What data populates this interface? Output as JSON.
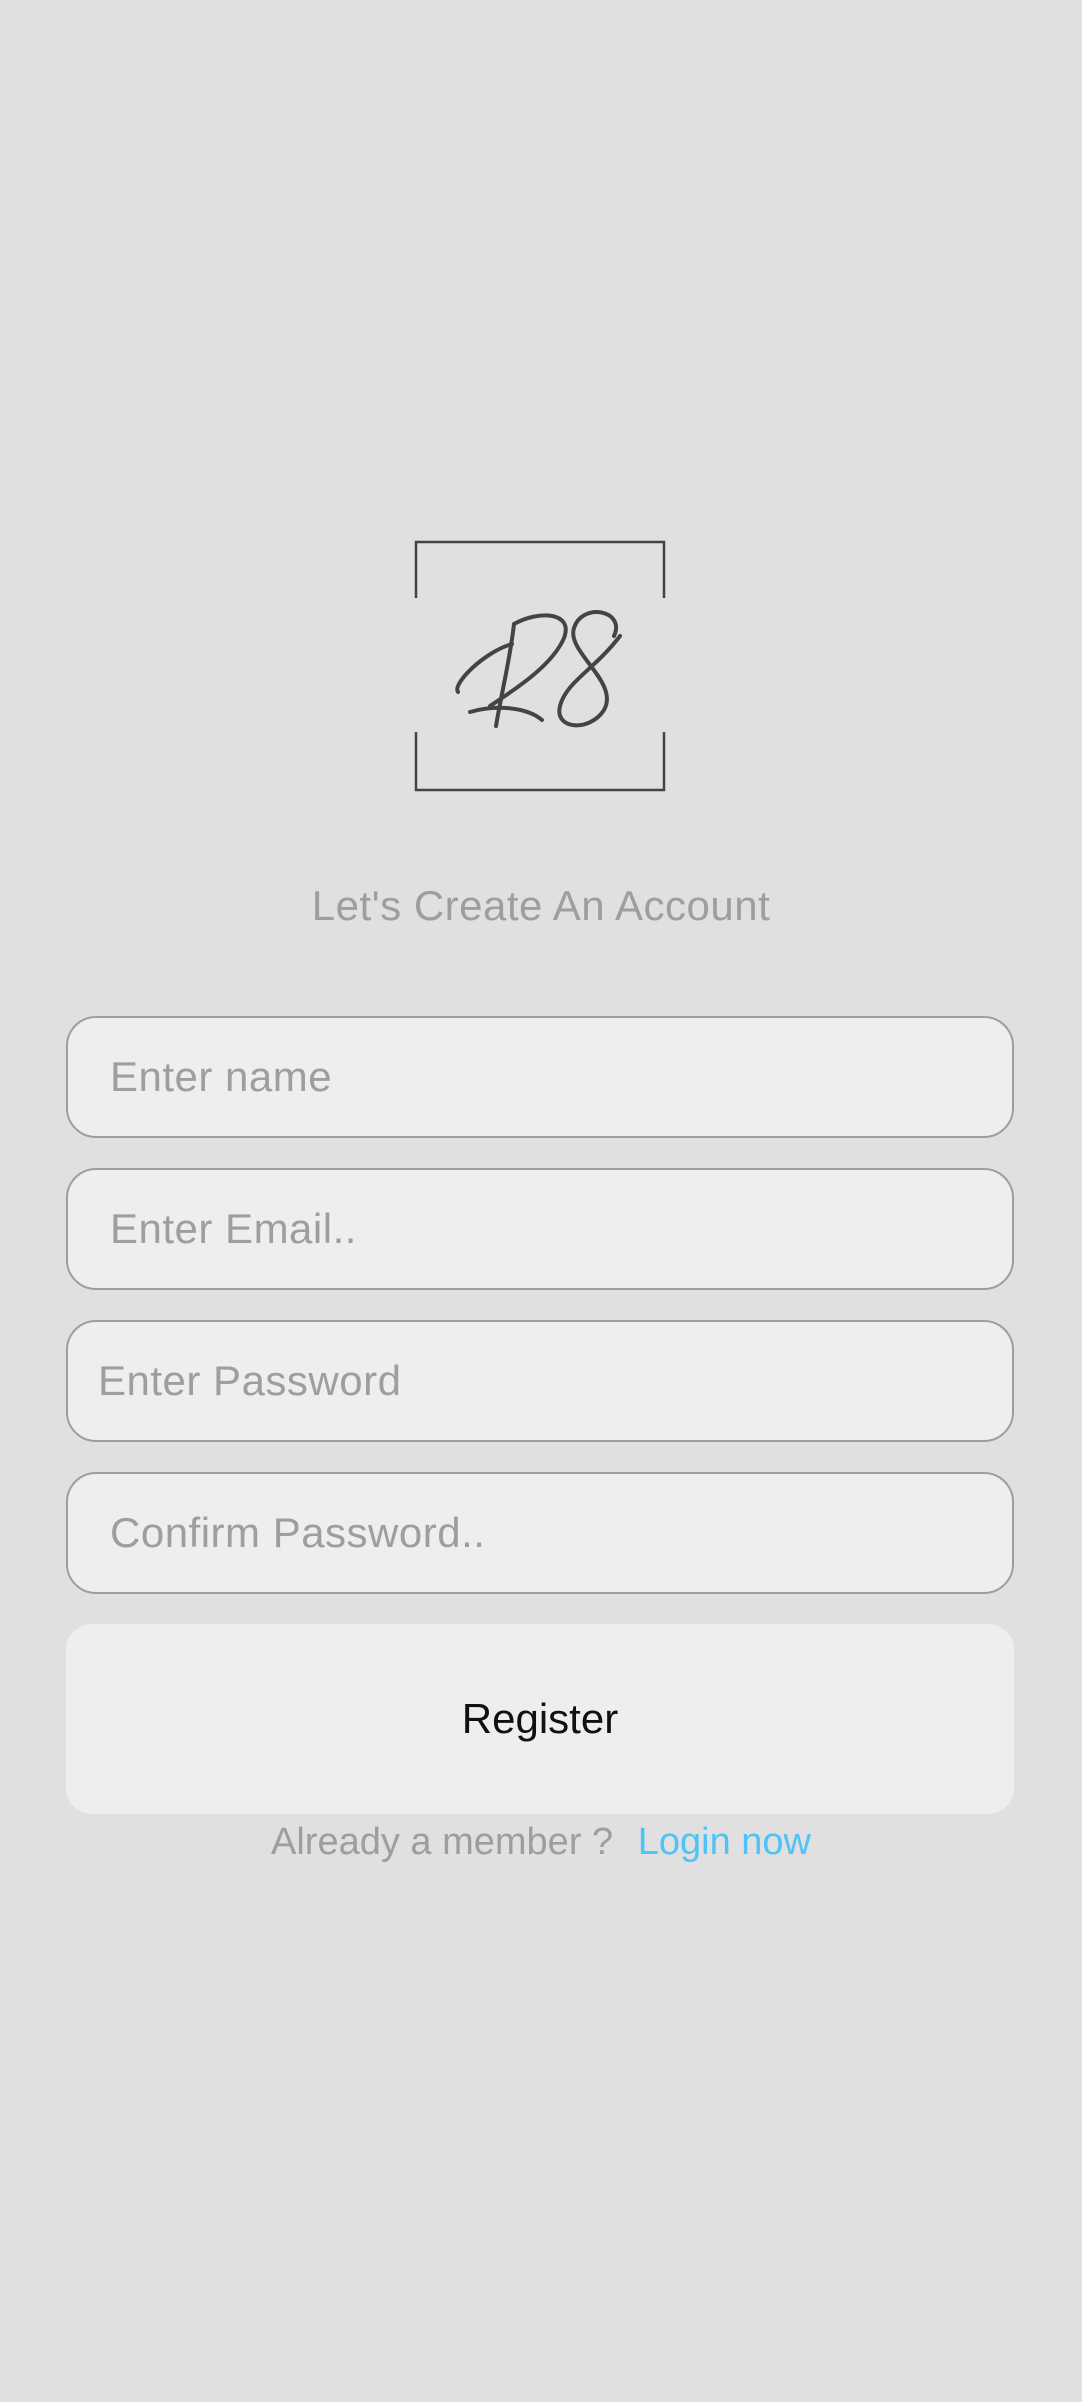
{
  "logo": {
    "text": "R8",
    "icon": "r8-monogram-logo",
    "stroke_color": "#444444"
  },
  "header": {
    "subtitle": "Let's Create An Account"
  },
  "form": {
    "name_placeholder": "Enter name",
    "email_placeholder": "Enter Email..",
    "password_placeholder": "Enter Password",
    "confirm_placeholder": "Confirm Password..",
    "register_label": "Register"
  },
  "footer": {
    "prompt": "Already a member ?",
    "login_label": "Login now",
    "link_color": "#4fc3f7"
  },
  "colors": {
    "background": "#e0e0e0",
    "field_background": "#eeeeee",
    "muted_text": "#9e9e9e"
  }
}
